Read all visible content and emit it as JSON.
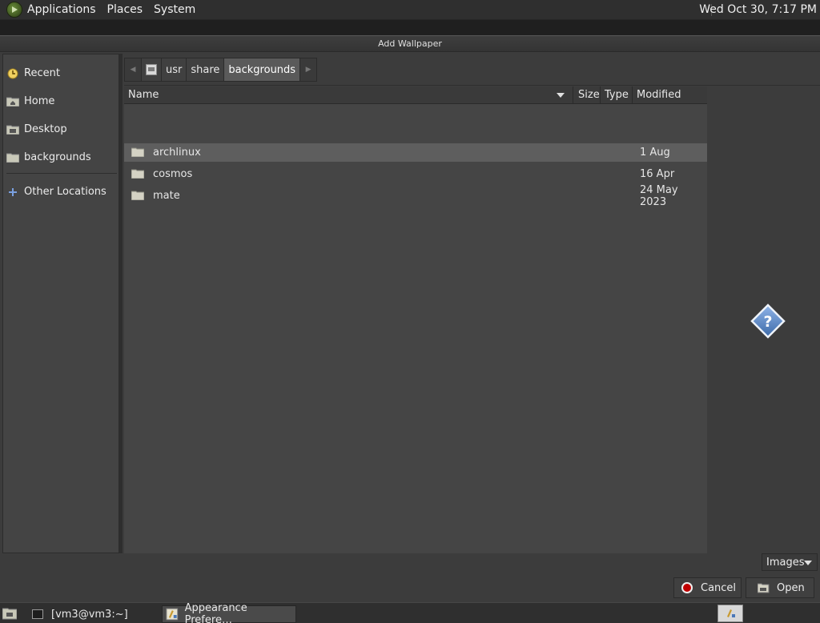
{
  "top_panel": {
    "menus": [
      "Applications",
      "Places",
      "System"
    ],
    "clock": "Wed Oct 30,  7:17 PM"
  },
  "dialog": {
    "title": "Add Wallpaper",
    "sidebar": {
      "items": [
        {
          "label": "Recent",
          "icon": "recent-icon"
        },
        {
          "label": "Home",
          "icon": "home-folder-icon"
        },
        {
          "label": "Desktop",
          "icon": "desktop-folder-icon"
        },
        {
          "label": "backgrounds",
          "icon": "folder-icon"
        },
        {
          "label": "Other Locations",
          "icon": "plus-icon"
        }
      ]
    },
    "pathbar": {
      "segments": [
        "usr",
        "share",
        "backgrounds"
      ],
      "active": "backgrounds"
    },
    "file_list": {
      "columns": [
        "Name",
        "Size",
        "Type",
        "Modified"
      ],
      "rows": [
        {
          "name": "archlinux",
          "size": "",
          "type": "",
          "modified": "1 Aug",
          "selected": true
        },
        {
          "name": "cosmos",
          "size": "",
          "type": "",
          "modified": "16 Apr",
          "selected": false
        },
        {
          "name": "mate",
          "size": "",
          "type": "",
          "modified": "24 May 2023",
          "selected": false
        }
      ]
    },
    "filter": "Images",
    "buttons": {
      "cancel": "Cancel",
      "open": "Open"
    }
  },
  "taskbar": {
    "tasks": [
      {
        "label": "[vm3@vm3:~]",
        "icon": "terminal-icon"
      },
      {
        "label": "Appearance Prefere…",
        "icon": "appearance-icon",
        "active": true
      }
    ]
  },
  "colors": {
    "panel": "#2f2f2f",
    "dialog_bg": "#3c3c3c",
    "list_bg": "#454545",
    "selected_row": "#5e5e5e",
    "cancel_red": "#c00000",
    "preview_blue": "#4a78b8"
  }
}
